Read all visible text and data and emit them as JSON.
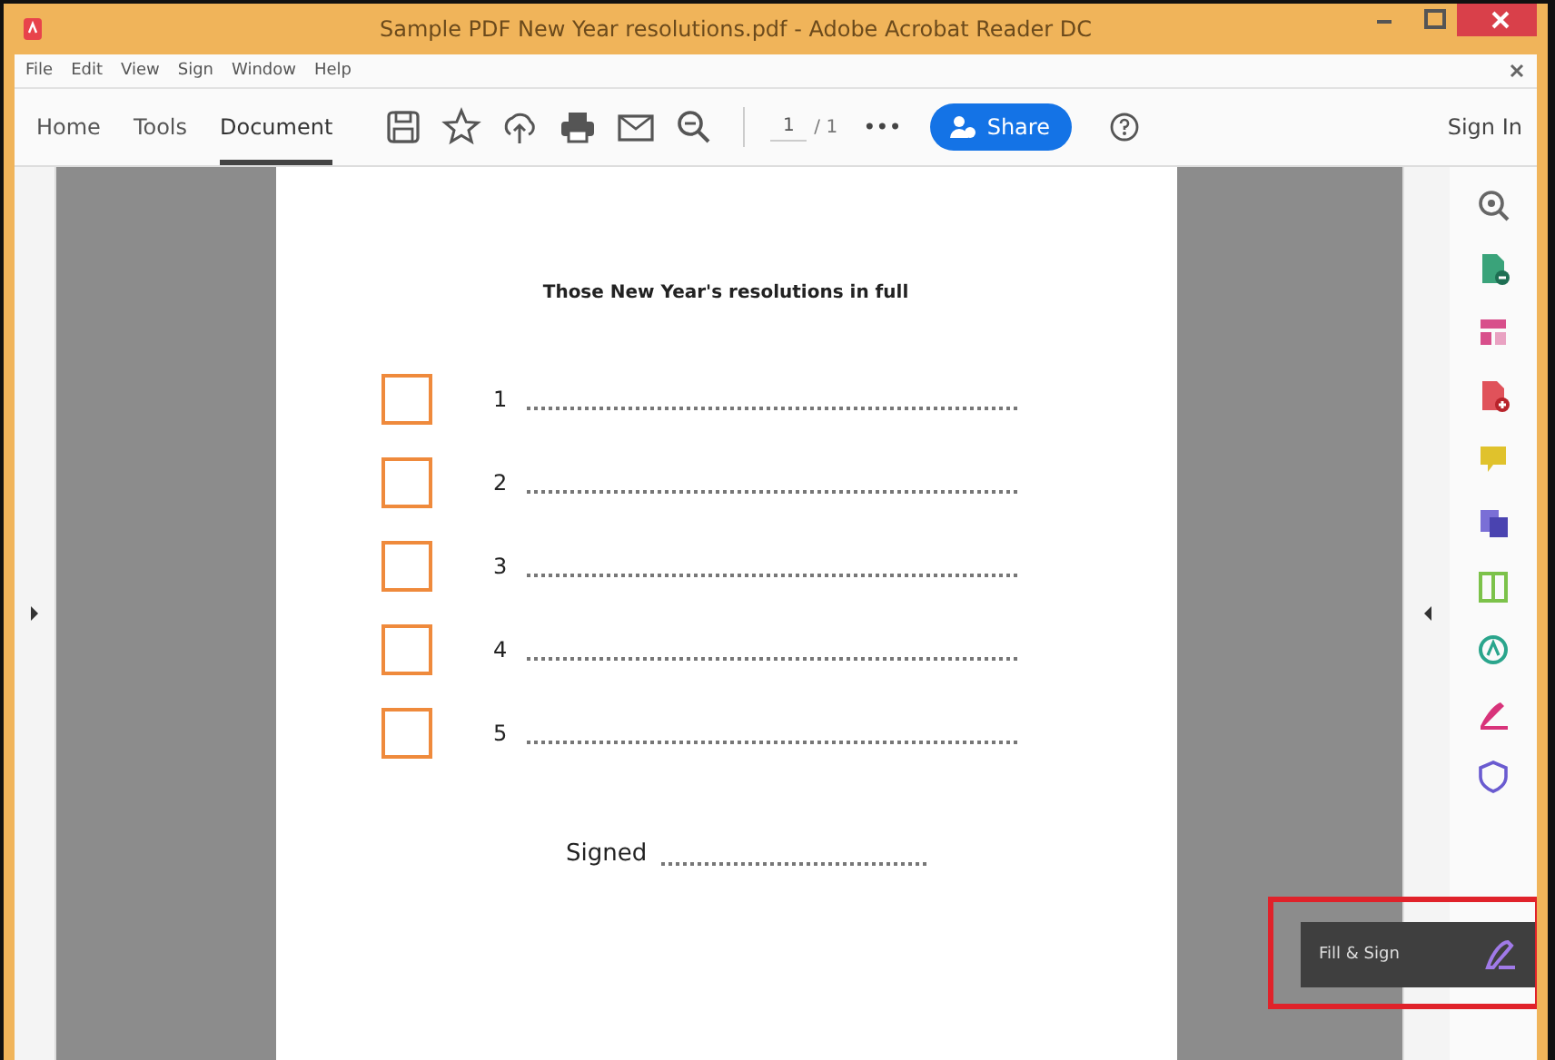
{
  "window": {
    "title": "Sample PDF New Year resolutions.pdf - Adobe Acrobat Reader DC"
  },
  "menu": [
    "File",
    "Edit",
    "View",
    "Sign",
    "Window",
    "Help"
  ],
  "tabs": [
    {
      "label": "Home",
      "selected": false
    },
    {
      "label": "Tools",
      "selected": false
    },
    {
      "label": "Document",
      "selected": true
    }
  ],
  "page_nav": {
    "value": "1",
    "total": "/ 1"
  },
  "more": "•••",
  "share": "Share",
  "sign_in": "Sign In",
  "document": {
    "title": "Those New Year's resolutions in full",
    "items": [
      {
        "number": "1",
        "checked": false
      },
      {
        "number": "2",
        "checked": false
      },
      {
        "number": "3",
        "checked": false
      },
      {
        "number": "4",
        "checked": false
      },
      {
        "number": "5",
        "checked": false
      }
    ],
    "signed": "Signed"
  },
  "tooltip": {
    "label": "Fill & Sign"
  }
}
